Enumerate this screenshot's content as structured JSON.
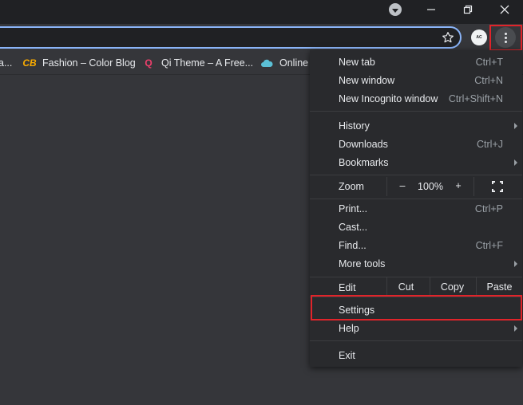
{
  "window": {
    "tab_search_icon": "chevron-down-circle",
    "controls": [
      "minimize",
      "restore",
      "close"
    ]
  },
  "toolbar": {
    "avatar_text": "AC",
    "star_icon": "star-outline",
    "menu_icon": "three-dots-vertical"
  },
  "bookmarks": [
    {
      "label": "a...",
      "icon": "bookmark-icon"
    },
    {
      "label": "Fashion – Color Blog",
      "icon": "cb-logo",
      "color": "#f9ab00"
    },
    {
      "label": "Qi Theme – A Free...",
      "icon": "qi-logo",
      "color": "#ee3f6b"
    },
    {
      "label": "Online",
      "icon": "cloud-logo",
      "color": "#5bc0d6"
    }
  ],
  "menu": {
    "new_tab": {
      "label": "New tab",
      "shortcut": "Ctrl+T"
    },
    "new_window": {
      "label": "New window",
      "shortcut": "Ctrl+N"
    },
    "new_incognito": {
      "label": "New Incognito window",
      "shortcut": "Ctrl+Shift+N"
    },
    "history": {
      "label": "History"
    },
    "downloads": {
      "label": "Downloads",
      "shortcut": "Ctrl+J"
    },
    "bookmarks": {
      "label": "Bookmarks"
    },
    "zoom": {
      "label": "Zoom",
      "minus": "–",
      "value": "100%",
      "plus": "+"
    },
    "print": {
      "label": "Print...",
      "shortcut": "Ctrl+P"
    },
    "cast": {
      "label": "Cast..."
    },
    "find": {
      "label": "Find...",
      "shortcut": "Ctrl+F"
    },
    "more_tools": {
      "label": "More tools"
    },
    "edit": {
      "label": "Edit",
      "cut": "Cut",
      "copy": "Copy",
      "paste": "Paste"
    },
    "settings": {
      "label": "Settings"
    },
    "help": {
      "label": "Help"
    },
    "exit": {
      "label": "Exit"
    }
  },
  "highlight_color": "#e0242a"
}
